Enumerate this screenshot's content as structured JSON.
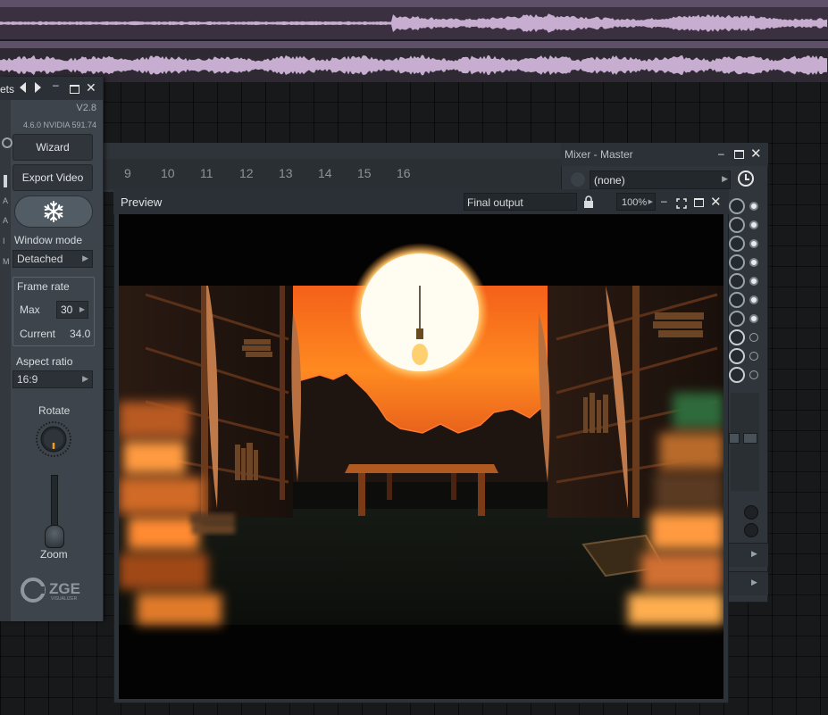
{
  "plugin": {
    "title_fragment": "ets",
    "version": "V2.8",
    "gpu_info": "4.6.0 NVIDIA 591.74",
    "wizard_label": "Wizard",
    "export_label": "Export Video",
    "freeze_icon": "snowflake-icon",
    "window_mode_label": "Window mode",
    "window_mode_value": "Detached",
    "frame_rate_label": "Frame rate",
    "max_label": "Max",
    "max_value": "30",
    "current_label": "Current",
    "current_value": "34.0",
    "aspect_label": "Aspect ratio",
    "aspect_value": "16:9",
    "rotate_label": "Rotate",
    "zoom_label": "Zoom",
    "logo_text": "ZGE",
    "logo_sub": "VISUALIZER",
    "side_letters": [
      "A",
      "A",
      "I",
      "M"
    ]
  },
  "rack": {
    "step_numbers": [
      "9",
      "10",
      "11",
      "12",
      "13",
      "14",
      "15",
      "16"
    ]
  },
  "mixer": {
    "title": "Mixer - Master",
    "selected": "(none)"
  },
  "preview": {
    "title": "Preview",
    "output_select": "Final output",
    "zoom": "100%"
  },
  "colors": {
    "accent_orange": "#f07a1a",
    "panel_bg": "#3d444b",
    "waveform": "#c7aed0"
  }
}
